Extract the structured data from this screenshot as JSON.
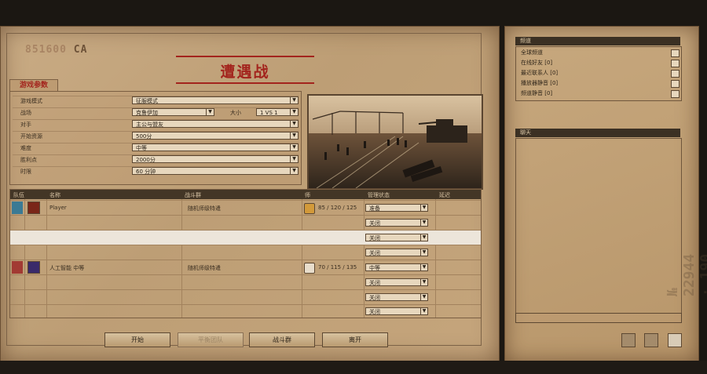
{
  "stamp": {
    "code": "851600",
    "suffix": "CA"
  },
  "title": "遭遇战",
  "tab": "游戏参数",
  "params": [
    {
      "label": "游戏模式",
      "value": "征服模式"
    },
    {
      "label": "战场",
      "value": "克鲁伊加",
      "size_label": "大小",
      "size_value": "1 VS 1"
    },
    {
      "label": "对手",
      "value": "主公与盟友"
    },
    {
      "label": "开始资源",
      "value": "500分"
    },
    {
      "label": "难度",
      "value": "中等"
    },
    {
      "label": "胜利点",
      "value": "2000分"
    },
    {
      "label": "时限",
      "value": "60 分钟"
    }
  ],
  "table": {
    "headers": [
      "队伍",
      "名称",
      "战斗群",
      "师",
      "管理状态",
      "延迟"
    ],
    "rows": [
      {
        "name": "Player",
        "group": "随机师级特遣",
        "stats": "85 / 120 / 125",
        "status": "准备",
        "team_color": "#3b7a94"
      },
      {
        "name": "",
        "group": "",
        "stats": "",
        "status": "关闭",
        "team_color": ""
      },
      {
        "name": "",
        "group": "",
        "stats": "",
        "status": "关闭",
        "team_color": ""
      },
      {
        "name": "",
        "group": "",
        "stats": "",
        "status": "关闭",
        "team_color": ""
      },
      {
        "name": "人工智能 中等",
        "group": "随机师级特遣",
        "stats": "70 / 115 / 135",
        "status": "中等",
        "team_color": "#a23a33"
      },
      {
        "name": "",
        "group": "",
        "stats": "",
        "status": "关闭",
        "team_color": ""
      },
      {
        "name": "",
        "group": "",
        "stats": "",
        "status": "关闭",
        "team_color": ""
      },
      {
        "name": "",
        "group": "",
        "stats": "",
        "status": "关闭",
        "team_color": ""
      }
    ]
  },
  "buttons": {
    "start": "开始",
    "balance": "平衡团队",
    "battlegroup": "战斗群",
    "leave": "离开"
  },
  "channels": {
    "header": "频道",
    "items": [
      "全球频道",
      "在线好友 [0]",
      "最近联系人 [0]",
      "播放器静音 [0]",
      "频道静音 [0]"
    ]
  },
  "chat": {
    "header": "聊天"
  },
  "watermark": [
    "№ 22944 · 190"
  ],
  "colors": {
    "accent": "#a3241d",
    "team_blue": "#3b7a94",
    "team_red": "#a23a33"
  }
}
